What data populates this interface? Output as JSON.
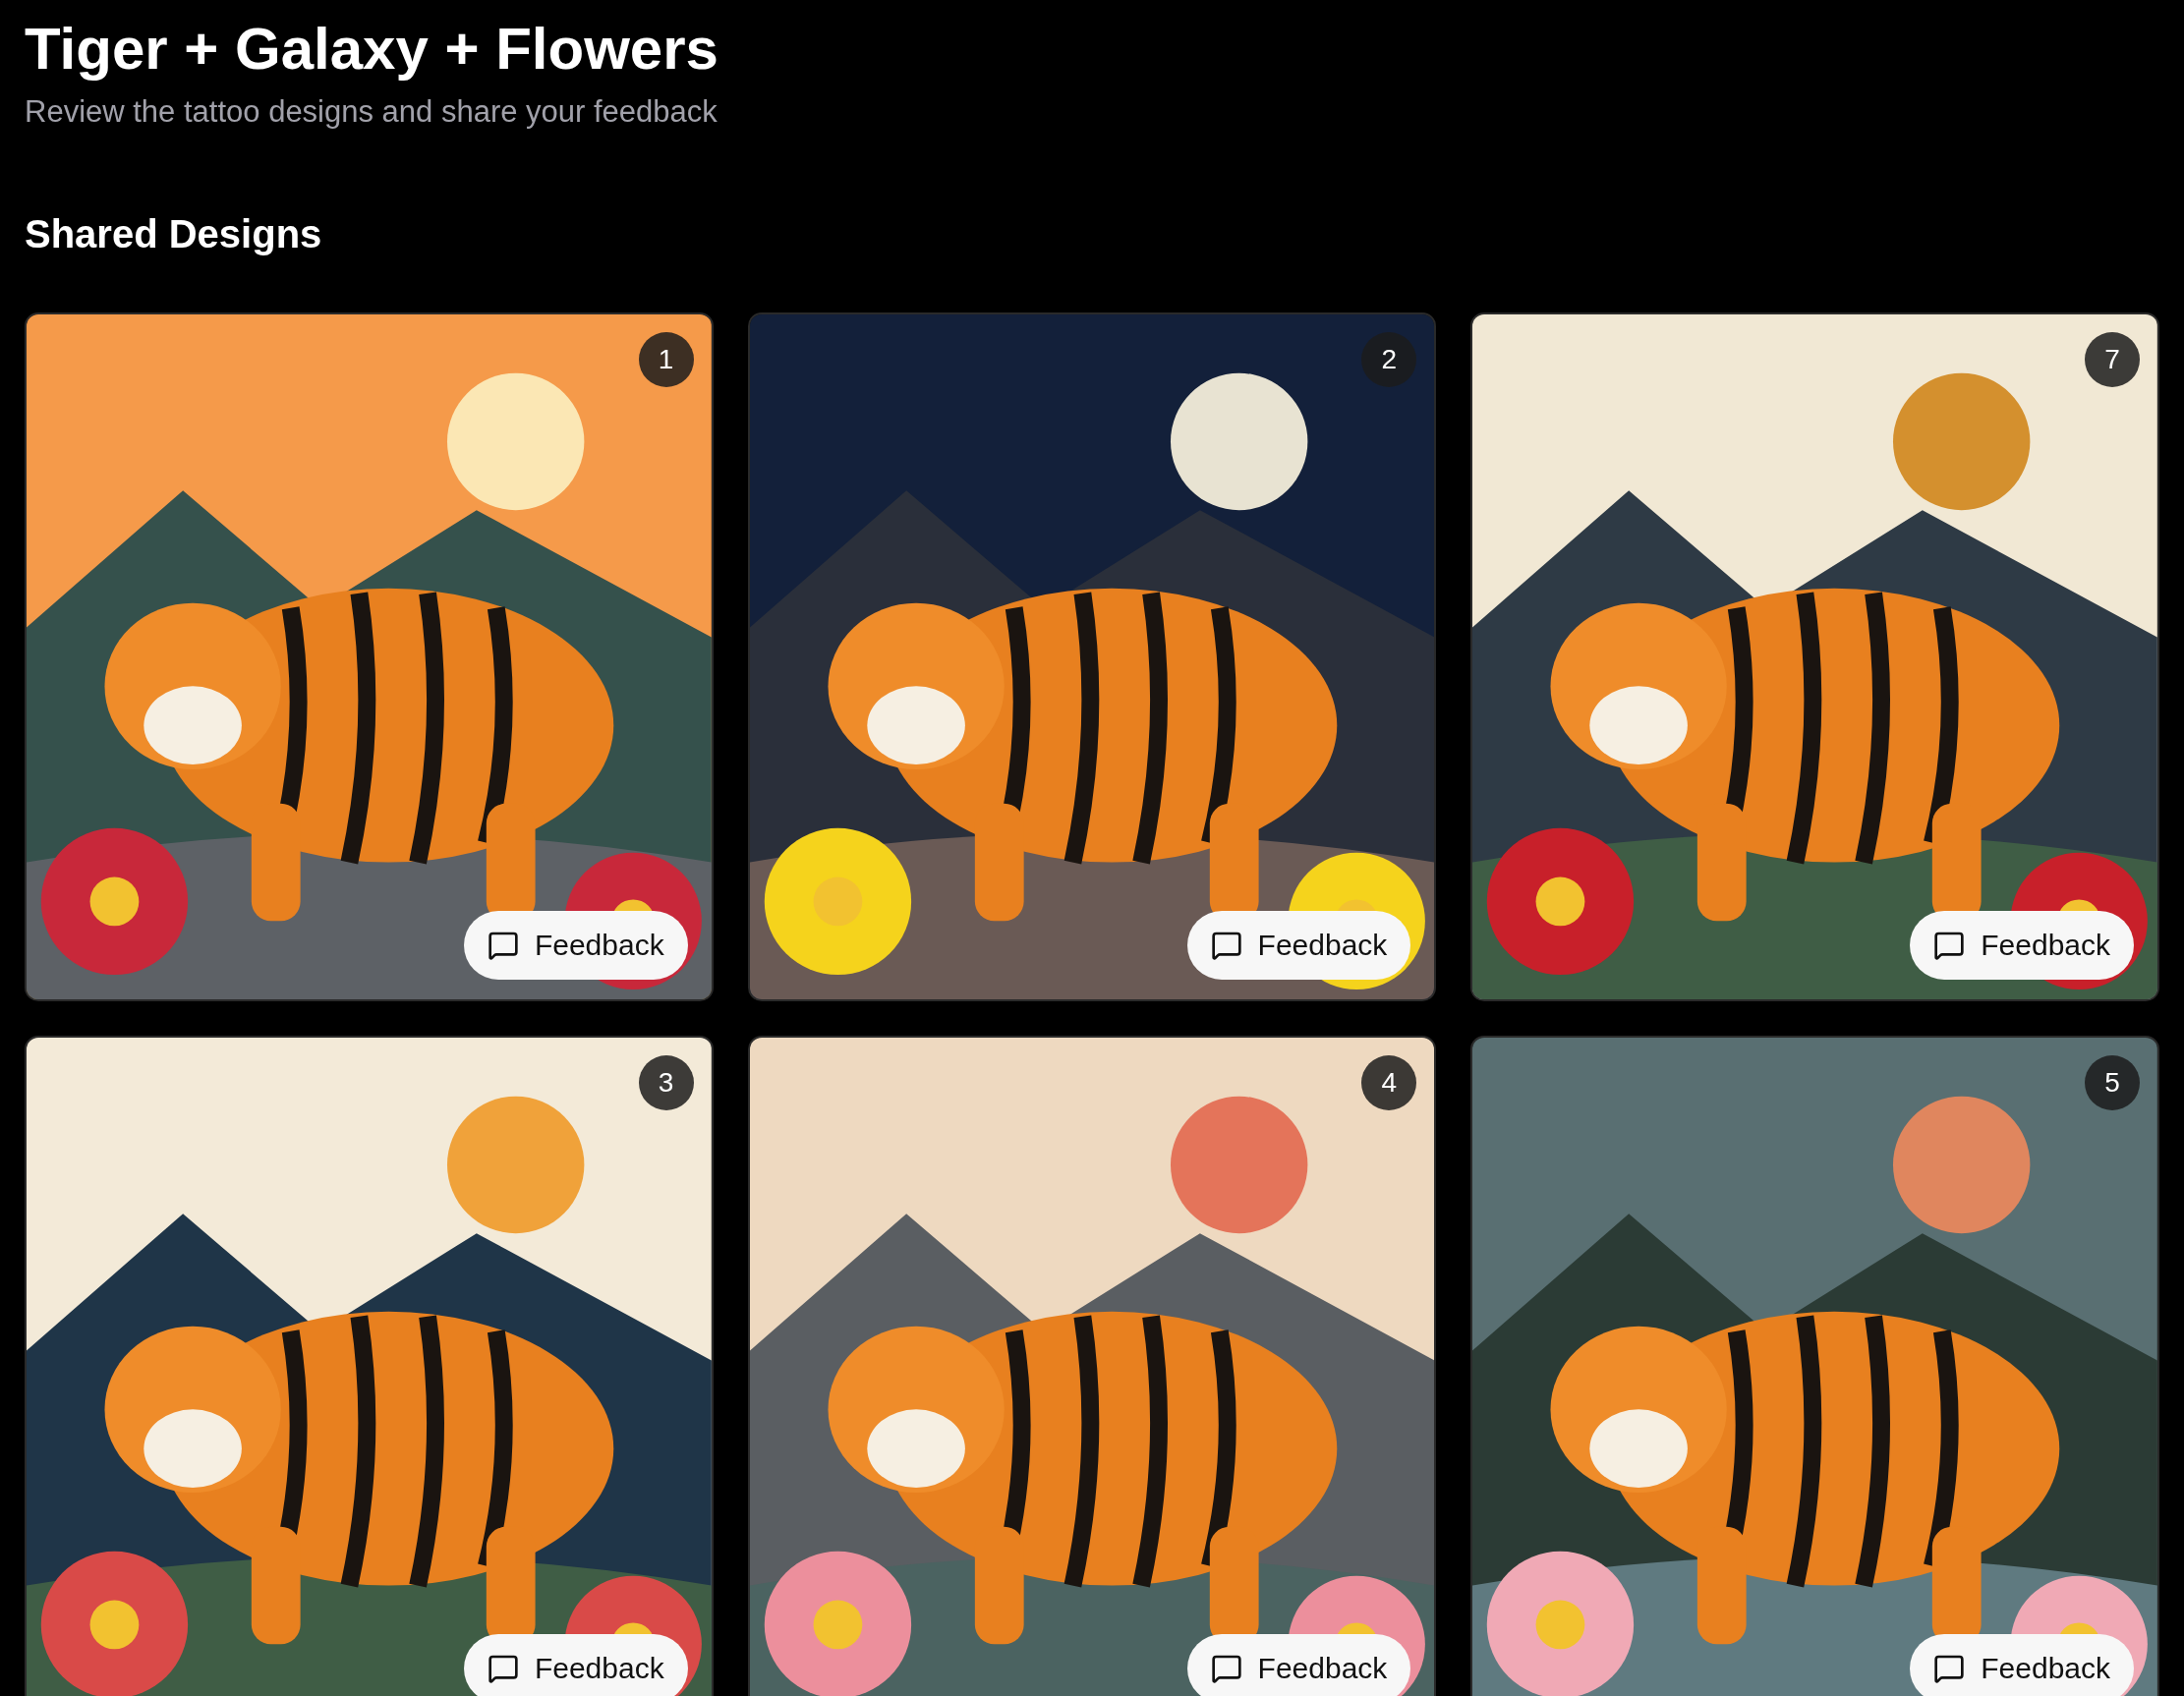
{
  "title": "Tiger + Galaxy + Flowers",
  "subtitle": "Review the tattoo designs and share your feedback",
  "section_title": "Shared Designs",
  "designs": [
    {
      "number": "1",
      "kind": "picture",
      "button": "Feedback"
    },
    {
      "number": "2",
      "kind": "picture",
      "button": "Feedback"
    },
    {
      "number": "7",
      "kind": "picture",
      "button": "Feedback"
    },
    {
      "number": "3",
      "kind": "picture",
      "button": "Feedback"
    },
    {
      "number": "4",
      "kind": "picture",
      "button": "Feedback"
    },
    {
      "number": "5",
      "kind": "picture",
      "button": "Feedback"
    }
  ]
}
